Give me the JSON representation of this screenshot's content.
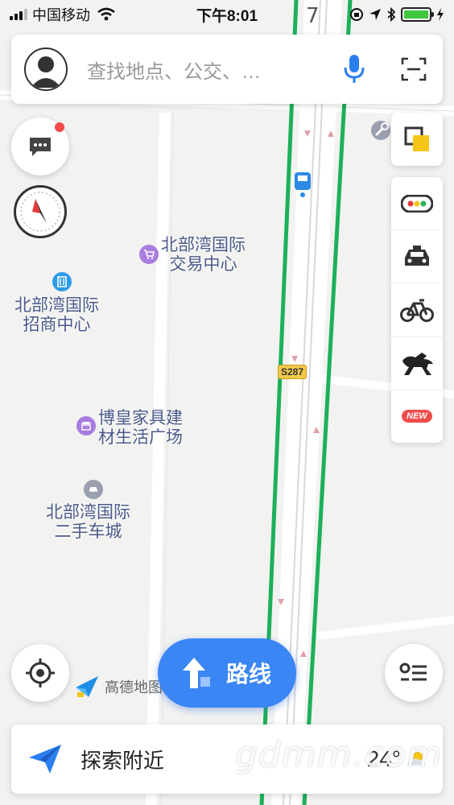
{
  "status_bar": {
    "carrier": "中国移动",
    "time": "下午8:01"
  },
  "search": {
    "placeholder": "查找地点、公交、…"
  },
  "map": {
    "pois": [
      {
        "name_line1": "北部湾国际",
        "name_line2": "交易中心",
        "icon": "shopping-cart-icon",
        "color": "#a97de0"
      },
      {
        "name_line1": "北部湾国际",
        "name_line2": "招商中心",
        "icon": "office-building-icon",
        "color": "#2e9ae8"
      },
      {
        "name_line1": "博皇家具建",
        "name_line2": "材生活广场",
        "icon": "market-icon",
        "color": "#a97de0"
      },
      {
        "name_line1": "北部湾国际",
        "name_line2": "二手车城",
        "icon": "car-icon",
        "color": "#9aa0b0"
      }
    ],
    "road_shield": "S287"
  },
  "toolbar": {
    "items": [
      {
        "icon": "traffic-light-icon"
      },
      {
        "icon": "taxi-icon"
      },
      {
        "icon": "bicycle-icon"
      },
      {
        "icon": "horse-icon"
      },
      {
        "icon": "new-badge",
        "label": "NEW"
      }
    ]
  },
  "route_button": {
    "label": "路线"
  },
  "logo": {
    "text": "高德地图"
  },
  "bottom_panel": {
    "label": "探索附近",
    "temperature": "24°"
  },
  "watermark": "gdmm.com",
  "colors": {
    "accent": "#3a86f5",
    "road_green": "#1cb05a",
    "badge_red": "#f24a4a"
  }
}
